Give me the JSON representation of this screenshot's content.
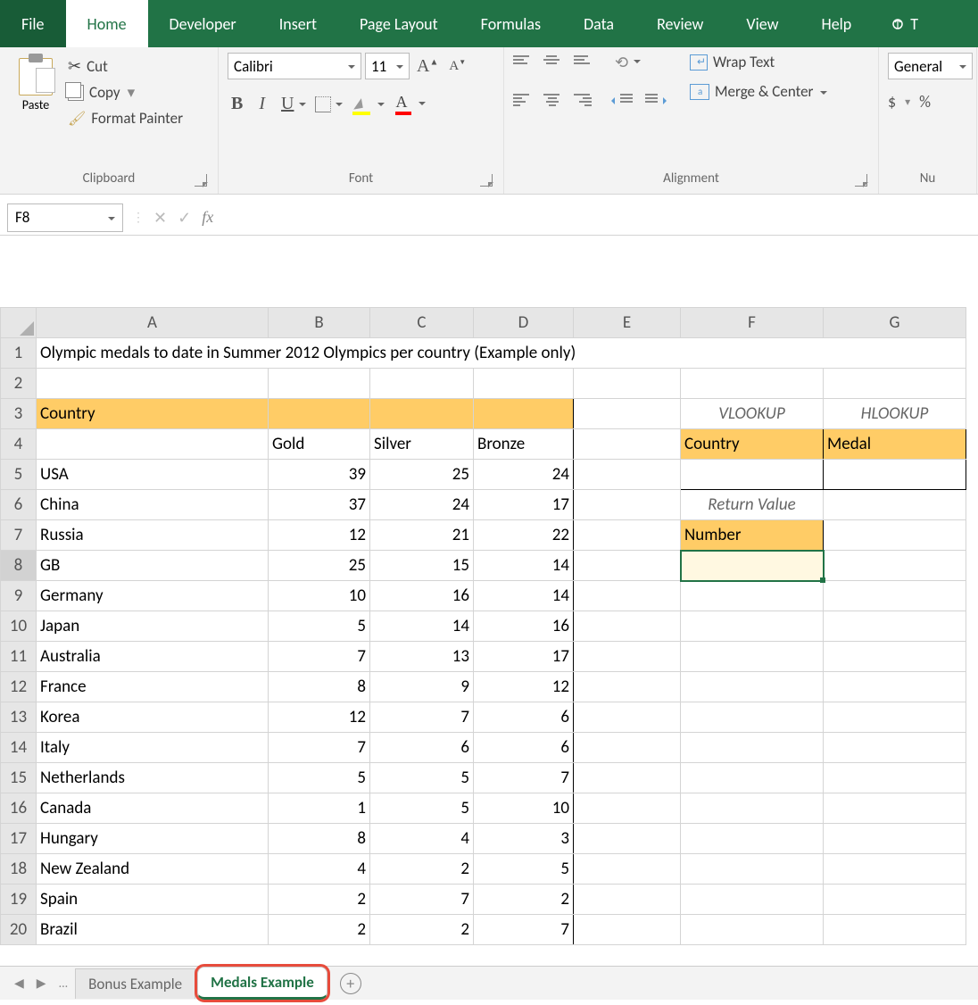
{
  "tabs": [
    "File",
    "Home",
    "Developer",
    "Insert",
    "Page Layout",
    "Formulas",
    "Data",
    "Review",
    "View",
    "Help"
  ],
  "active_tab": "Home",
  "clipboard": {
    "paste": "Paste",
    "cut": "Cut",
    "copy": "Copy",
    "fmt": "Format Painter",
    "label": "Clipboard"
  },
  "font": {
    "name": "Calibri",
    "size": "11",
    "label": "Font"
  },
  "alignment": {
    "wrap": "Wrap Text",
    "merge": "Merge & Center",
    "label": "Alignment"
  },
  "number": {
    "format": "General",
    "label": "Nu",
    "dollar": "$",
    "percent": "%"
  },
  "name_box": "F8",
  "fx": "fx",
  "columns": [
    "A",
    "B",
    "C",
    "D",
    "E",
    "F",
    "G"
  ],
  "title": "Olympic medals to date in Summer 2012 Olympics per country (Example only)",
  "header": {
    "country": "Country",
    "gold": "Gold",
    "silver": "Silver",
    "bronze": "Bronze"
  },
  "lookup": {
    "vlookup": "VLOOKUP",
    "hlookup": "HLOOKUP",
    "country": "Country",
    "medal": "Medal",
    "ret": "Return Value",
    "number": "Number"
  },
  "rows": [
    {
      "n": 5,
      "c": "USA",
      "g": 39,
      "s": 25,
      "b": 24
    },
    {
      "n": 6,
      "c": "China",
      "g": 37,
      "s": 24,
      "b": 17
    },
    {
      "n": 7,
      "c": "Russia",
      "g": 12,
      "s": 21,
      "b": 22
    },
    {
      "n": 8,
      "c": "GB",
      "g": 25,
      "s": 15,
      "b": 14
    },
    {
      "n": 9,
      "c": "Germany",
      "g": 10,
      "s": 16,
      "b": 14
    },
    {
      "n": 10,
      "c": "Japan",
      "g": 5,
      "s": 14,
      "b": 16
    },
    {
      "n": 11,
      "c": "Australia",
      "g": 7,
      "s": 13,
      "b": 17
    },
    {
      "n": 12,
      "c": "France",
      "g": 8,
      "s": 9,
      "b": 12
    },
    {
      "n": 13,
      "c": "Korea",
      "g": 12,
      "s": 7,
      "b": 6
    },
    {
      "n": 14,
      "c": "Italy",
      "g": 7,
      "s": 6,
      "b": 6
    },
    {
      "n": 15,
      "c": "Netherlands",
      "g": 5,
      "s": 5,
      "b": 7
    },
    {
      "n": 16,
      "c": "Canada",
      "g": 1,
      "s": 5,
      "b": 10
    },
    {
      "n": 17,
      "c": "Hungary",
      "g": 8,
      "s": 4,
      "b": 3
    },
    {
      "n": 18,
      "c": "New Zealand",
      "g": 4,
      "s": 2,
      "b": 5
    },
    {
      "n": 19,
      "c": "Spain",
      "g": 2,
      "s": 7,
      "b": 2
    },
    {
      "n": 20,
      "c": "Brazil",
      "g": 2,
      "s": 2,
      "b": 7
    }
  ],
  "sheets": {
    "dots": "...",
    "bonus": "Bonus Example",
    "medals": "Medals Example"
  }
}
